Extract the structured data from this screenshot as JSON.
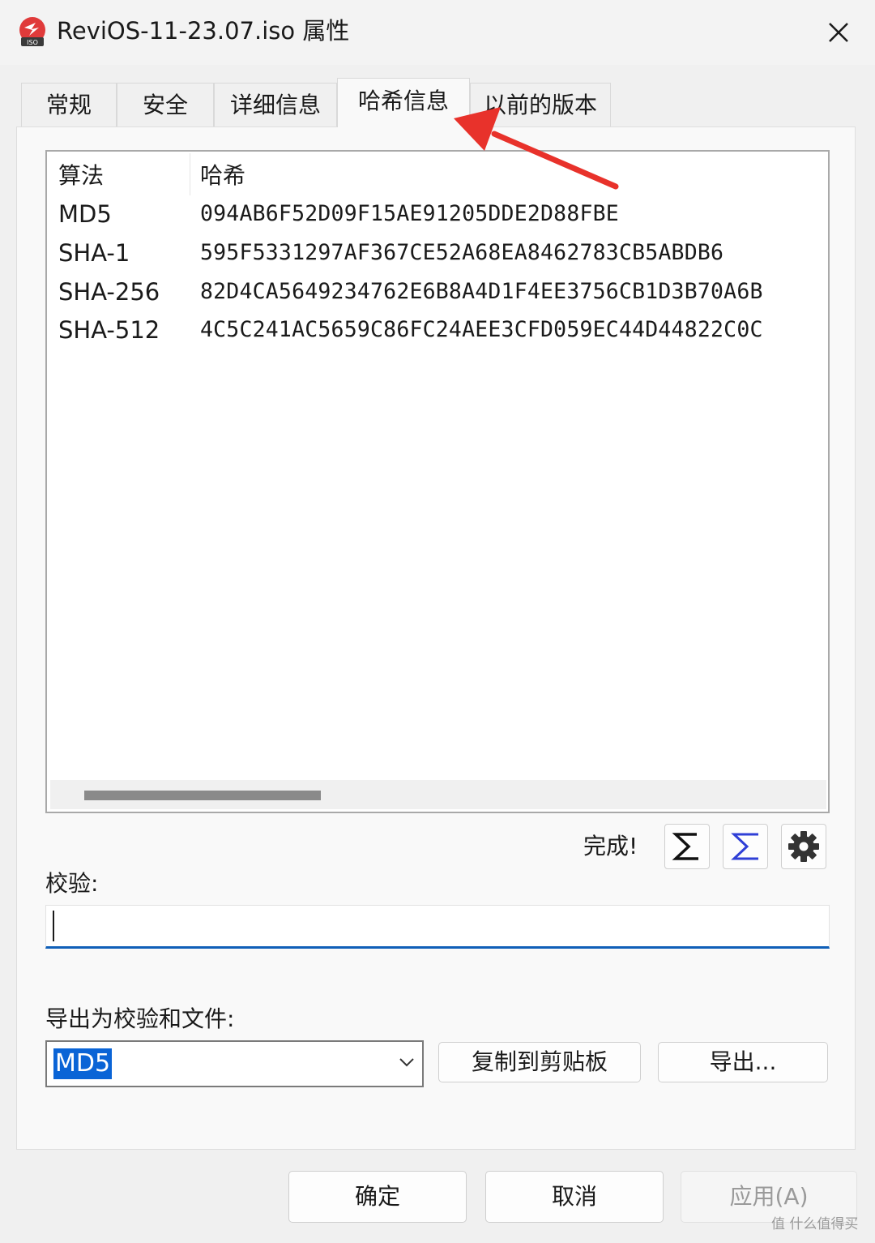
{
  "window": {
    "title": "ReviOS-11-23.07.iso 属性",
    "icon_name": "iso-file-icon",
    "close_label": "✕"
  },
  "tabs": [
    {
      "label": "常规",
      "active": false
    },
    {
      "label": "安全",
      "active": false
    },
    {
      "label": "详细信息",
      "active": false
    },
    {
      "label": "哈希信息",
      "active": true
    },
    {
      "label": "以前的版本",
      "active": false
    }
  ],
  "hash_list": {
    "columns": [
      "算法",
      "哈希"
    ],
    "rows": [
      {
        "algorithm": "MD5",
        "hash": "094AB6F52D09F15AE91205DDE2D88FBE"
      },
      {
        "algorithm": "SHA-1",
        "hash": "595F5331297AF367CE52A68EA8462783CB5ABDB6"
      },
      {
        "algorithm": "SHA-256",
        "hash": "82D4CA5649234762E6B8A4D1F4EE3756CB1D3B70A6B"
      },
      {
        "algorithm": "SHA-512",
        "hash": "4C5C241AC5659C86FC24AEE3CFD059EC44D44822C0C"
      }
    ]
  },
  "status": {
    "text": "完成!",
    "buttons": [
      {
        "icon": "sigma-icon"
      },
      {
        "icon": "sigma-compare-icon"
      },
      {
        "icon": "gear-icon"
      }
    ]
  },
  "verify": {
    "label": "校验:",
    "value": ""
  },
  "export": {
    "label": "导出为校验和文件:",
    "selected_algorithm": "MD5",
    "copy_label": "复制到剪贴板",
    "export_label": "导出..."
  },
  "footer": {
    "ok_label": "确定",
    "cancel_label": "取消",
    "apply_label": "应用(A)"
  },
  "watermark": "值 什么值得买",
  "colors": {
    "accent": "#0f5fb8",
    "selection": "#0a64d6",
    "annotation_arrow": "#e8322b",
    "app_icon": "#e03a3a"
  }
}
